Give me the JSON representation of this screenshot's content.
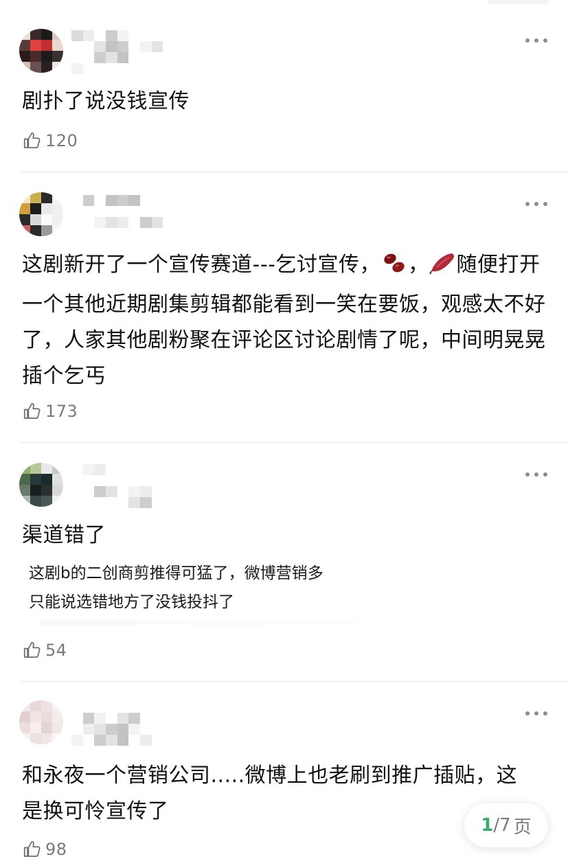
{
  "comments": [
    {
      "text": "剧扑了说没钱宣传",
      "likes": "120",
      "avatar_colors": [
        "#e8e0d8",
        "#3a2a2a",
        "#1b1b1b",
        "#d8c8c0",
        "#5a3a3a",
        "#e04040",
        "#c03030",
        "#e8d8d0",
        "#2a1a1a",
        "#4a2a2a",
        "#1b1b1b",
        "#3a3030",
        "#d0c0b8",
        "#6a5050",
        "#2a2020",
        "#ece4de"
      ]
    },
    {
      "text_before": "这剧新开了一个宣传赛道---乞讨宣传，",
      "text_middle": "，",
      "text_after": "随便打开一个其他近期剧集剪辑都能看到一笑在要饭，观感太不好了，人家其他剧粉聚在评论区讨论剧情了呢，中间明晃晃插个乞丐",
      "emoji_1": "beans-emoji",
      "emoji_2": "sweet-potato-emoji",
      "likes": "173",
      "avatar_colors": [
        "#f0e8c8",
        "#c8b050",
        "#2a2a2a",
        "#f4f4f4",
        "#d0a040",
        "#1c1c1c",
        "#e8e8e8",
        "#f0f0f0",
        "#2a2a2a",
        "#d8d8d8",
        "#fafafa",
        "#f0f0f0",
        "#d06060",
        "#2a2a2a",
        "#9a9a9a",
        "#f6f6f6"
      ]
    },
    {
      "text": "渠道错了",
      "quote_lines": [
        "这剧b的二创商剪推得可猛了，微博营销多",
        "只能说选错地方了没钱投抖了"
      ],
      "likes": "54",
      "avatar_colors": [
        "#90b070",
        "#b8c898",
        "#e8e8e8",
        "#c8c8c8",
        "#4a6a4a",
        "#2a3a3a",
        "#1a2a2a",
        "#e0e0e0",
        "#6a7a6a",
        "#1a2020",
        "#2a3030",
        "#d8d8d8",
        "#b0b8b0",
        "#3a4a4a",
        "#4a5858",
        "#f0f0f0"
      ]
    },
    {
      "text": "和永夜一个营销公司.....微博上也老刷到推广插贴，这是换可怜宣传了",
      "likes": "98",
      "avatar_colors": [
        "#f4eaea",
        "#e8d8d8",
        "#f0e0e0",
        "#f8f0f0",
        "#e0d0d0",
        "#f0e4e4",
        "#e8dcdc",
        "#f4ecec",
        "#ecdede",
        "#f6eeee",
        "#e4d4d4",
        "#f2e8e8",
        "#f8f4f4",
        "#ece0e0",
        "#f0e6e6",
        "#faf6f6"
      ]
    }
  ],
  "nick_colors": [
    "#d8d8d8",
    "#ececec",
    "#c8c8c8",
    "#f2f2f2",
    "#e0e0e0",
    "#bdbdbd"
  ],
  "pager": {
    "current": "1",
    "total": "/7",
    "unit": "页"
  },
  "colors": {
    "accent": "#3aaa6e",
    "muted": "#7a7a7a"
  }
}
